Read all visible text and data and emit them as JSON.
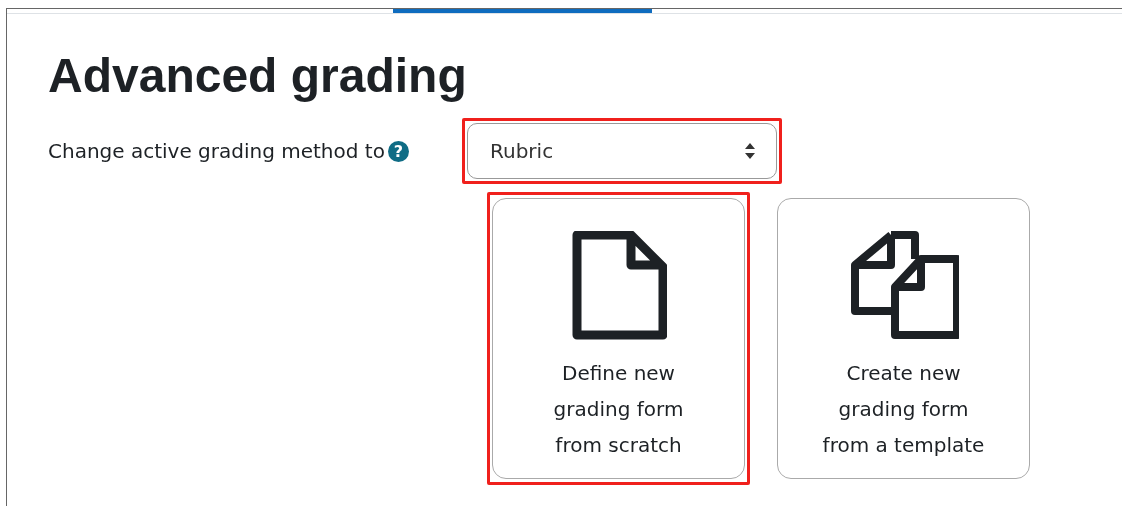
{
  "heading": "Advanced grading",
  "method_field": {
    "label": "Change active grading method to",
    "help_icon": "?",
    "value": "Rubric",
    "highlighted": true
  },
  "options": [
    {
      "kind": "blank",
      "label": "Define new grading form from scratch",
      "highlighted": true
    },
    {
      "kind": "template",
      "label": "Create new grading form from a template",
      "highlighted": false
    }
  ]
}
